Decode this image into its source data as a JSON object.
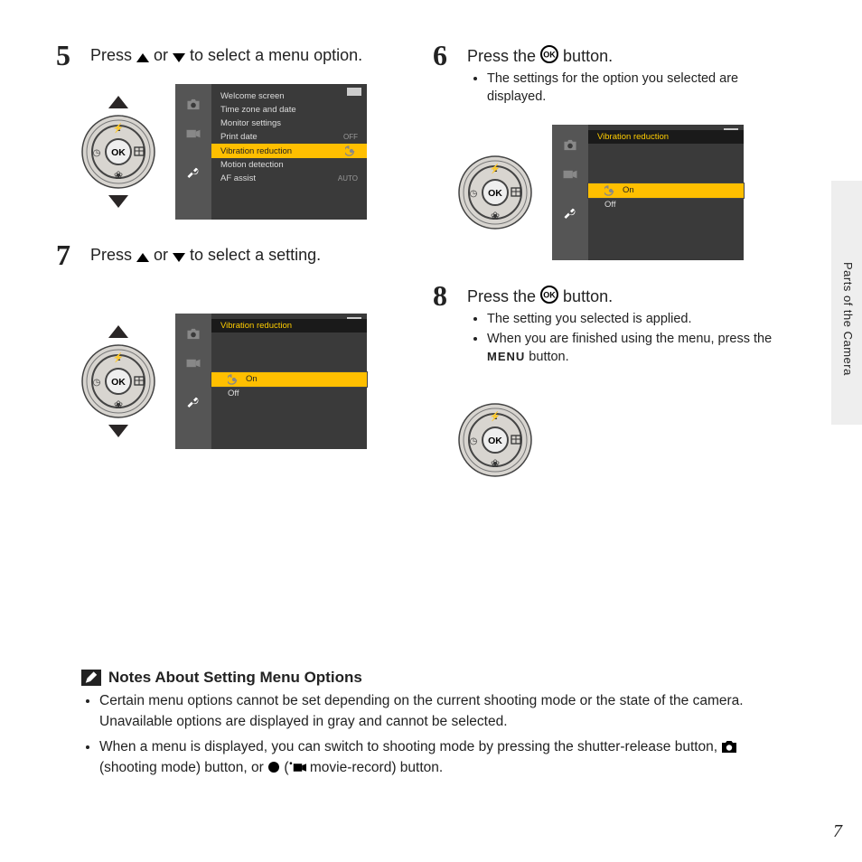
{
  "sideSection": "Parts of the Camera",
  "pageNumber": "7",
  "steps": {
    "s5": {
      "num": "5",
      "pre": "Press ",
      "mid": " or ",
      "post": " to select a menu option."
    },
    "s6": {
      "num": "6",
      "pre": "Press the ",
      "post": " button.",
      "bullets": [
        "The settings for the option you selected are displayed."
      ]
    },
    "s7": {
      "num": "7",
      "pre": "Press ",
      "mid": " or ",
      "post": " to select a setting."
    },
    "s8": {
      "num": "8",
      "pre": "Press the ",
      "post": " button.",
      "bullets": [
        "The setting you selected is applied.",
        "When you are finished using the menu, press the "
      ],
      "bullet2_menu": "MENU",
      "bullet2_post": " button."
    }
  },
  "lcd": {
    "setup": {
      "header": "",
      "items": [
        {
          "label": "Welcome screen",
          "val": ""
        },
        {
          "label": "Time zone and date",
          "val": ""
        },
        {
          "label": "Monitor settings",
          "val": ""
        },
        {
          "label": "Print date",
          "val": "OFF"
        },
        {
          "label": "Vibration reduction",
          "val": "",
          "selected": true
        },
        {
          "label": "Motion detection",
          "val": ""
        },
        {
          "label": "AF assist",
          "val": "AUTO"
        }
      ]
    },
    "vr": {
      "header": "Vibration reduction",
      "options": [
        {
          "label": "On",
          "selected": true
        },
        {
          "label": "Off",
          "selected": false
        }
      ]
    }
  },
  "notes": {
    "heading": "Notes About Setting Menu Options",
    "items": [
      "Certain menu options cannot be set depending on the current shooting mode or the state of the camera. Unavailable options are displayed in gray and cannot be selected.",
      "When a menu is displayed, you can switch to shooting mode by pressing the shutter-release button, "
    ],
    "item2_mid1": " (shooting mode) button, or ",
    "item2_mid2": " (",
    "item2_mid3": " movie-record) button."
  }
}
